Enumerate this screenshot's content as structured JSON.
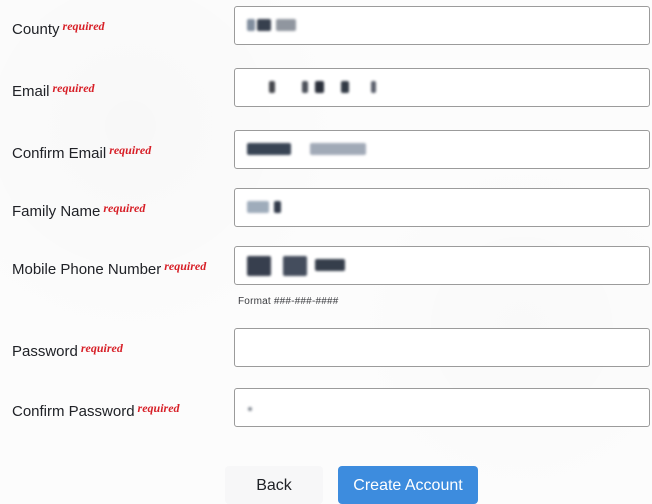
{
  "form": {
    "fields": [
      {
        "label": "County",
        "required": "required",
        "value": "redacted"
      },
      {
        "label": "Email",
        "required": "required",
        "value": "redacted"
      },
      {
        "label": "Confirm Email",
        "required": "required",
        "value": "redacted"
      },
      {
        "label": "Family Name",
        "required": "required",
        "value": "redacted"
      },
      {
        "label": "Mobile Phone Number",
        "required": "required",
        "value": "redacted",
        "helper": "Format ###-###-####"
      },
      {
        "label": "Password",
        "required": "required",
        "value": ""
      },
      {
        "label": "Confirm Password",
        "required": "required",
        "value": "redacted"
      }
    ]
  },
  "actions": {
    "back_label": "Back",
    "create_label": "Create Account"
  },
  "colors": {
    "required": "#d71f27",
    "primary": "#3d8cde",
    "border": "#9b9b9b",
    "text": "#202227"
  }
}
